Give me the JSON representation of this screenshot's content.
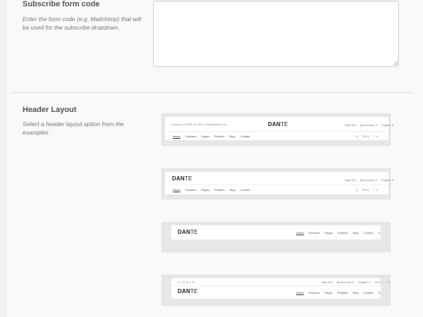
{
  "subscribe": {
    "title": "Subscribe form code",
    "description": "Enter the form code (e.g. Mailchimp) that will be used for the subscribe dropdown.",
    "value": ""
  },
  "header_layout": {
    "title": "Header Layout",
    "description": "Select a header layout option from the examples.",
    "logo_bold": "DAN",
    "logo_light": "TE",
    "nav": [
      "Home",
      "Features",
      "Pages",
      "Portfolio",
      "Blog",
      "Contact"
    ],
    "topbar_left": "Contact us on 0800 123 4567 or info@website.com",
    "topbar_right": [
      "Sign Out",
      "My Account ∨",
      "English ∨"
    ],
    "cart_label": "☰ 23",
    "wishlist_label": "♡ 0",
    "social_icons": "◎  f  Ⓟ  ⊕  ✓  ✉",
    "option4_topbar_right": [
      "Sign Out",
      "My Account ∨",
      "English ∨",
      "☰ 23",
      "♡ 0"
    ]
  }
}
